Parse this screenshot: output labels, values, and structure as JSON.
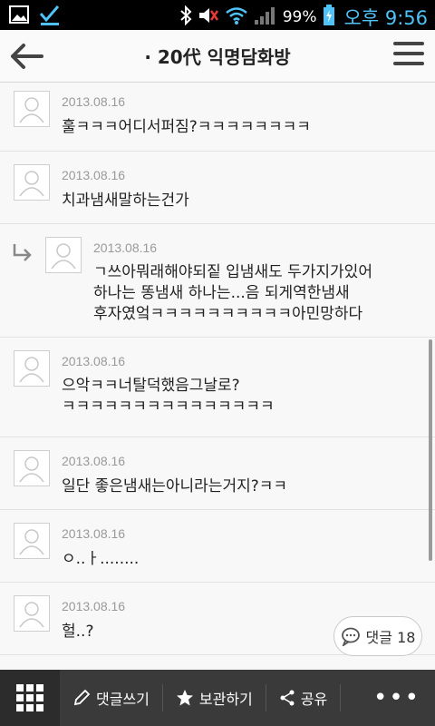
{
  "status_bar": {
    "battery": "99%",
    "time": "오후 9:56",
    "icons": [
      "gallery-icon",
      "check-icon",
      "bluetooth-icon",
      "mute-icon",
      "wifi-icon",
      "signal-icon",
      "battery-charging-icon"
    ]
  },
  "header": {
    "title": "· 20代 익명담화방"
  },
  "comments": [
    {
      "date": "2013.08.16",
      "text": "훌ㅋㅋㅋ어디서퍼짐?ㅋㅋㅋㅋㅋㅋㅋㅋ"
    },
    {
      "date": "2013.08.16",
      "text": "치과냄새말하는건가"
    },
    {
      "date": "2013.08.16",
      "text": "ㄱ쓰아뭐래해야되짙 입냄새도 두가지가있어\n하나는 똥냄새 하나는...음 되게역한냄새\n후자였엌ㅋㅋㅋㅋㅋㅋㅋㅋㅋㅋ아민망하다",
      "reply": true
    },
    {
      "date": "2013.08.16",
      "text": "으악ㅋㅋ너탈덕했음그날로?\nㅋㅋㅋㅋㅋㅋㅋㅋㅋㅋㅋㅋㅋㅋㅋ"
    },
    {
      "date": "2013.08.16",
      "text": "일단 좋은냄새는아니라는거지?ㅋㅋ"
    },
    {
      "date": "2013.08.16",
      "text": "ㅇ..ㅏ........"
    },
    {
      "date": "2013.08.16",
      "text": "헐..?"
    }
  ],
  "comment_count_button": {
    "label": "댓글 18"
  },
  "toolbar": {
    "write_comment": "댓글쓰기",
    "bookmark": "보관하기",
    "share": "공유",
    "more": "•••"
  },
  "colors": {
    "toolbar_bg": "#3a3a3a",
    "time_color": "#4fc3f7",
    "date_color": "#9a9a9a"
  }
}
